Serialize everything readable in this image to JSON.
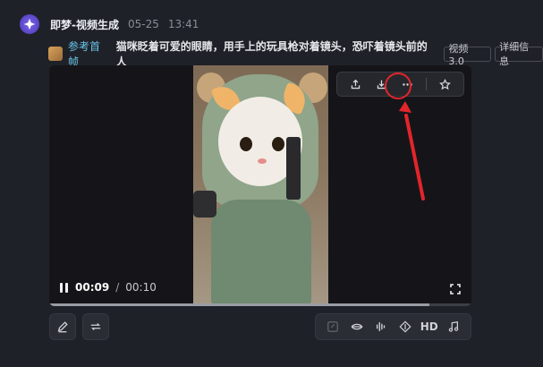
{
  "header": {
    "app_name": "即梦-视频生成",
    "date": "05-25",
    "time": "13:41"
  },
  "prompt_row": {
    "reference_label": "参考首帧",
    "prompt": "猫咪眨着可爱的眼睛，用手上的玩具枪对着镜头，恐吓着镜头前的人",
    "model_tag": "视频 3.0",
    "details_tag": "详细信息"
  },
  "player": {
    "current_time": "00:09",
    "time_separator": "/",
    "total_time": "00:10",
    "progress_fraction": 0.9,
    "top_controls": [
      "share-icon",
      "download-icon",
      "more-icon",
      "star-icon"
    ]
  },
  "tools": {
    "hd_label": "HD"
  },
  "colors": {
    "accent": "#6a54e0",
    "link": "#68c5e7",
    "highlight": "#e2252b"
  }
}
